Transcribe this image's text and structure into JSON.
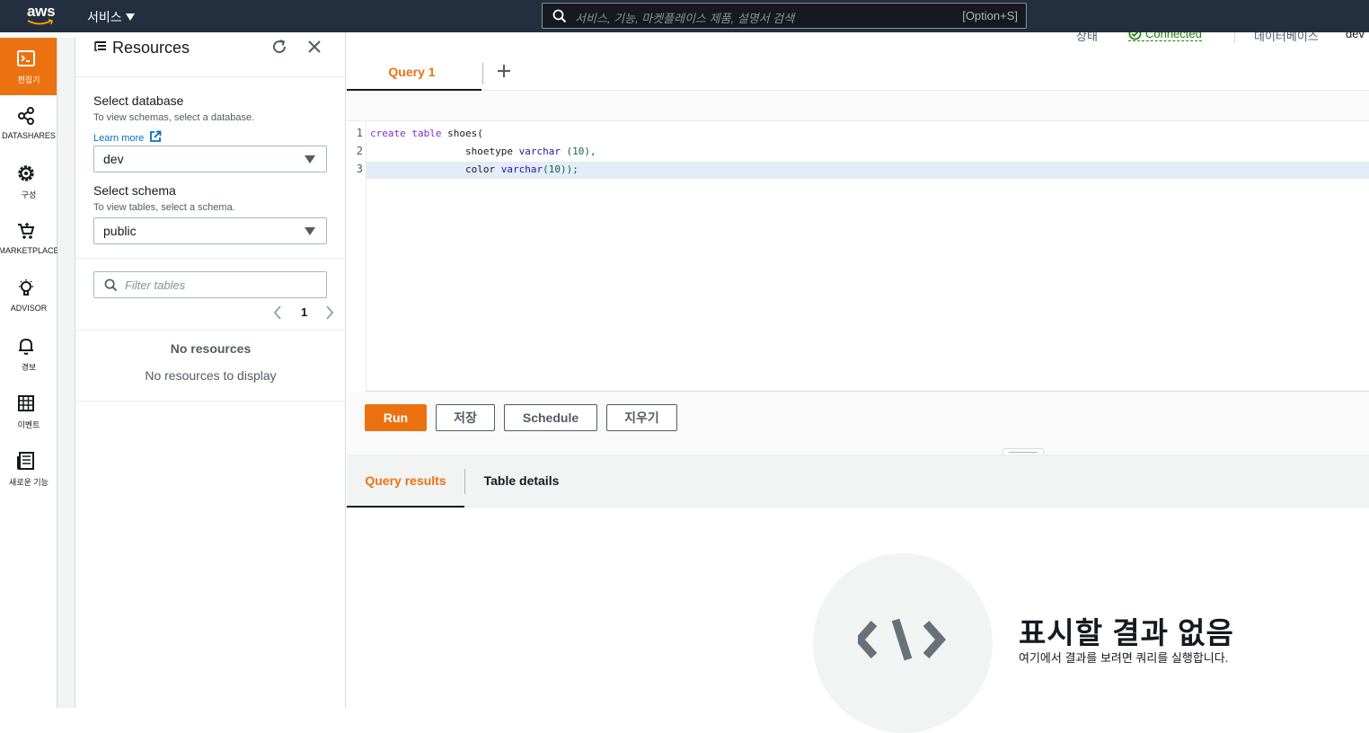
{
  "topnav": {
    "logo_text": "aws",
    "services_label": "서비스",
    "search_placeholder": "서비스, 기능, 마켓플레이스 제품, 설명서 검색",
    "search_shortcut": "[Option+S]"
  },
  "rail": {
    "items": [
      {
        "label": "편집기",
        "icon": "terminal-icon",
        "active": true
      },
      {
        "label": "DATASHARES",
        "icon": "share-icon",
        "active": false
      },
      {
        "label": "구성",
        "icon": "gear-icon",
        "active": false
      },
      {
        "label": "MARKETPLACE",
        "icon": "cart-icon",
        "active": false
      },
      {
        "label": "ADVISOR",
        "icon": "lightbulb-icon",
        "active": false
      },
      {
        "label": "경보",
        "icon": "bell-icon",
        "active": false
      },
      {
        "label": "이벤트",
        "icon": "calendar-icon",
        "active": false
      },
      {
        "label": "새로운 기능",
        "icon": "newspaper-icon",
        "active": false
      }
    ]
  },
  "resources": {
    "title": "Resources",
    "database": {
      "label": "Select database",
      "desc": "To view schemas, select a database.",
      "learn_more": "Learn more",
      "value": "dev"
    },
    "schema": {
      "label": "Select schema",
      "desc": "To view tables, select a schema.",
      "value": "public"
    },
    "filter_placeholder": "Filter tables",
    "page": "1",
    "empty_title": "No resources",
    "empty_desc": "No resources to display"
  },
  "status": {
    "state_label": "상태",
    "connection": "Connected",
    "database_label": "데이터베이스",
    "database_value": "dev"
  },
  "editor": {
    "tab_label": "Query 1",
    "lines": [
      {
        "no": "1",
        "kw": "create table",
        "rest": " shoes("
      },
      {
        "no": "2",
        "indent": "                ",
        "name": "shoetype",
        "type": "varchar",
        "rest": " (10),"
      },
      {
        "no": "3",
        "indent": "                ",
        "name": "color",
        "type": "varchar",
        "rest": "(10));"
      }
    ]
  },
  "buttons": {
    "run": "Run",
    "save": "저장",
    "schedule": "Schedule",
    "clear": "지우기"
  },
  "results": {
    "tab_query_results": "Query results",
    "tab_table_details": "Table details",
    "empty_title": "표시할 결과 없음",
    "empty_desc": "여기에서 결과를 보려면 쿼리를 실행합니다."
  },
  "colors": {
    "accent": "#ec7211",
    "nav_bg": "#232f3e",
    "connected": "#1d8102",
    "link": "#0073bb"
  }
}
